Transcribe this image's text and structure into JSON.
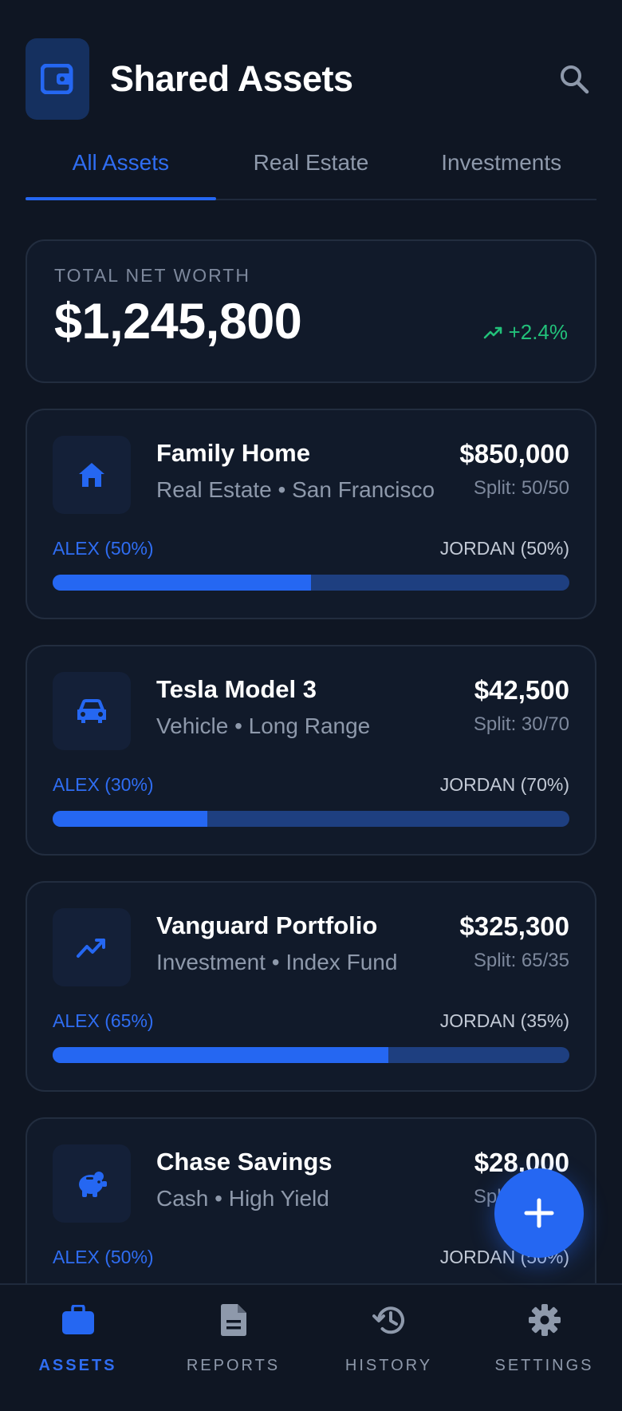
{
  "header": {
    "title": "Shared Assets"
  },
  "tabs": [
    {
      "label": "All Assets",
      "active": true
    },
    {
      "label": "Real Estate",
      "active": false
    },
    {
      "label": "Investments",
      "active": false
    }
  ],
  "networth": {
    "label": "TOTAL NET WORTH",
    "value": "$1,245,800",
    "change": "+2.4%"
  },
  "assets": [
    {
      "name": "Family Home",
      "subtitle": "Real Estate • San Francisco",
      "value": "$850,000",
      "split": "Split: 50/50",
      "owner_a": "ALEX (50%)",
      "owner_b": "JORDAN (50%)",
      "share_a": 50,
      "icon": "house-icon"
    },
    {
      "name": "Tesla Model 3",
      "subtitle": "Vehicle • Long Range",
      "value": "$42,500",
      "split": "Split: 30/70",
      "owner_a": "ALEX (30%)",
      "owner_b": "JORDAN (70%)",
      "share_a": 30,
      "icon": "car-icon"
    },
    {
      "name": "Vanguard Portfolio",
      "subtitle": "Investment • Index Fund",
      "value": "$325,300",
      "split": "Split: 65/35",
      "owner_a": "ALEX (65%)",
      "owner_b": "JORDAN (35%)",
      "share_a": 65,
      "icon": "trending-up-icon"
    },
    {
      "name": "Chase Savings",
      "subtitle": "Cash • High Yield",
      "value": "$28,000",
      "split": "Split: 50/50",
      "owner_a": "ALEX (50%)",
      "owner_b": "JORDAN (50%)",
      "share_a": 50,
      "icon": "piggy-bank-icon"
    }
  ],
  "nav": [
    {
      "label": "ASSETS",
      "active": true,
      "icon": "briefcase-icon"
    },
    {
      "label": "REPORTS",
      "active": false,
      "icon": "document-icon"
    },
    {
      "label": "HISTORY",
      "active": false,
      "icon": "history-icon"
    },
    {
      "label": "SETTINGS",
      "active": false,
      "icon": "gear-icon"
    }
  ],
  "colors": {
    "accent": "#2567f2",
    "background": "#0f1623",
    "card": "#111a2a",
    "positive": "#22c17a",
    "muted": "#8e99ab"
  }
}
